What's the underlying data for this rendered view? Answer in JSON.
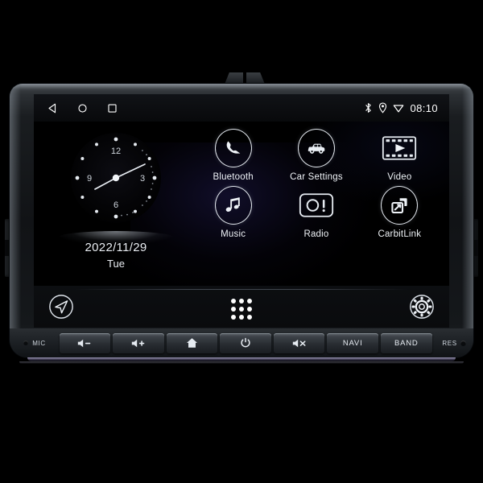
{
  "device": {
    "name": "Car Android Head Unit",
    "mount_tabs": [
      "top-tab-left",
      "top-tab-right",
      "side-tab-left",
      "side-tab-right"
    ]
  },
  "statusbar": {
    "nav": [
      {
        "name": "back-icon",
        "label": "Back"
      },
      {
        "name": "home-icon",
        "label": "Home"
      },
      {
        "name": "recents-icon",
        "label": "Recents"
      }
    ],
    "icons": [
      {
        "name": "bluetooth-icon",
        "label": "Bluetooth"
      },
      {
        "name": "location-icon",
        "label": "Location"
      },
      {
        "name": "wifi-icon",
        "label": "Wi-Fi"
      }
    ],
    "time": "08:10"
  },
  "clock_widget": {
    "numerals": [
      "12",
      "3",
      "6",
      "9"
    ],
    "hour_hand_deg": 245,
    "minute_hand_deg": 60,
    "date": "2022/11/29",
    "weekday": "Tue"
  },
  "apps": [
    {
      "label": "Bluetooth",
      "icon": "bluetooth-phone-icon"
    },
    {
      "label": "Car Settings",
      "icon": "car-icon"
    },
    {
      "label": "Video",
      "icon": "film-play-icon"
    },
    {
      "label": "Music",
      "icon": "music-note-icon"
    },
    {
      "label": "Radio",
      "icon": "radio-icon"
    },
    {
      "label": "CarbitLink",
      "icon": "carbitlink-icon"
    }
  ],
  "dock": {
    "left": {
      "name": "navigation-arrow-icon",
      "label": "Navigation"
    },
    "center": {
      "name": "app-drawer-icon",
      "label": "All Apps"
    },
    "right": {
      "name": "gear-icon",
      "label": "Settings"
    }
  },
  "hardware_keys": {
    "mic_label": "MIC",
    "reset_label": "RES",
    "keys": [
      {
        "label": "",
        "icon": "volume-down-icon",
        "name": "volume-down-key"
      },
      {
        "label": "",
        "icon": "volume-up-icon",
        "name": "volume-up-key"
      },
      {
        "label": "",
        "icon": "home-key-icon",
        "name": "home-key"
      },
      {
        "label": "",
        "icon": "power-icon",
        "name": "power-key"
      },
      {
        "label": "",
        "icon": "mute-icon",
        "name": "mute-key"
      },
      {
        "label": "NAVI",
        "icon": "",
        "name": "navi-key"
      },
      {
        "label": "BAND",
        "icon": "",
        "name": "band-key"
      }
    ]
  },
  "colors": {
    "screen_bg": "#000000",
    "text": "#eef2f6",
    "bezel": "#1a1d20",
    "reflection": "#302878"
  }
}
